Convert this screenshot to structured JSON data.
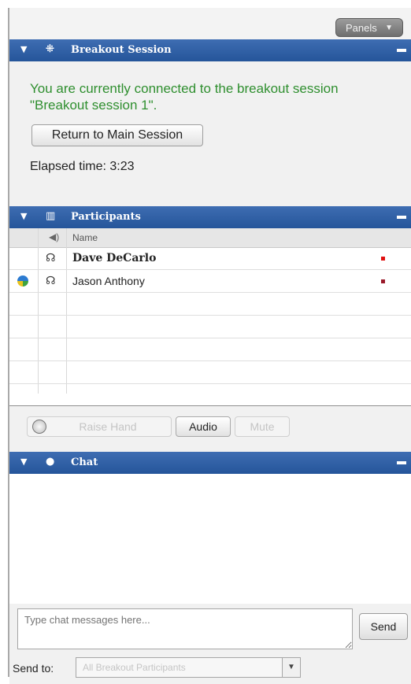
{
  "toolbar": {
    "panels_label": "Panels",
    "panels_chevron": "▼"
  },
  "breakout": {
    "title": "Breakout Session",
    "connected_message": "You are currently connected to the breakout session \"Breakout session 1\".",
    "return_button": "Return to Main Session",
    "elapsed_label": "Elapsed time:",
    "elapsed_value": "3:23"
  },
  "participants": {
    "title": "Participants",
    "column_name": "Name",
    "rows": [
      {
        "name": "Dave DeCarlo",
        "bold": true,
        "status_color": "#e01010"
      },
      {
        "name": "Jason Anthony",
        "bold": false,
        "status_color": "#9a1a2a"
      }
    ]
  },
  "controls": {
    "raise_hand": "Raise Hand",
    "audio": "Audio",
    "mute": "Mute"
  },
  "chat": {
    "title": "Chat",
    "input_placeholder": "Type chat messages here...",
    "send_button": "Send",
    "send_to_label": "Send to:",
    "send_to_value": "All Breakout Participants"
  },
  "colors": {
    "header_blue": "#2f5ea3",
    "message_green": "#2f8f2f"
  }
}
